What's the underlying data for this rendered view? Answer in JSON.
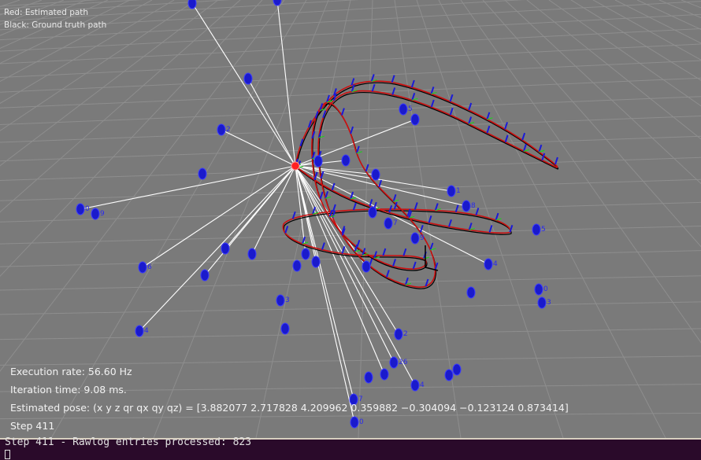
{
  "legend": {
    "estimated": "Red: Estimated path",
    "ground_truth": "Black: Ground truth path"
  },
  "info": {
    "execution_rate": "Execution rate: 56.60  Hz",
    "iteration_time": "Iteration time:  9.08 ms.",
    "estimated_pose": "Estimated pose: (x y z qr qx qy qz) = [3.882077 2.717828 4.209962 0.359882 −0.304094 −0.123124 0.873414]",
    "step": "Step 411"
  },
  "console": {
    "line": "Step 411 - Rawlog entries processed: 823"
  },
  "landmark_labels": [
    "0",
    "9",
    "6",
    "2",
    "3",
    "4",
    "5",
    "1",
    "8",
    "7",
    "9",
    "4",
    "5",
    "0",
    "3",
    "2",
    "26",
    "4",
    "7",
    "0"
  ],
  "colors": {
    "ground": "#7a7a7a",
    "grid": "#8e8e8e",
    "estimated_path": "#cc1010",
    "ground_truth_path": "#000000",
    "landmark": "#1a1acc",
    "observation_ray": "#ffffff",
    "covariance_marker": "#22cc22",
    "console_bg": "#2a0a2a"
  }
}
